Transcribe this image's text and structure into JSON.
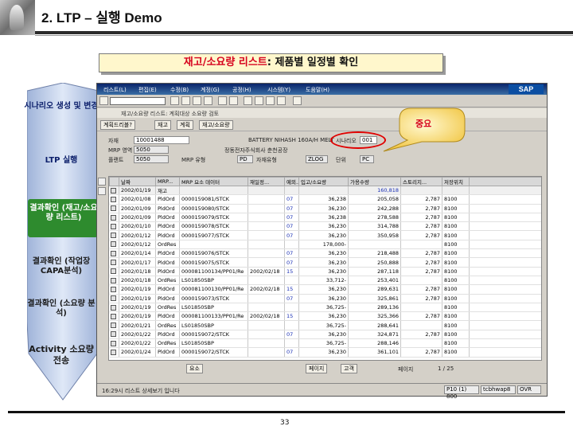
{
  "slide": {
    "title": "2. LTP – 실행 Demo",
    "subtitle_red": "재고/소요량 리스트",
    "subtitle_rest": ": 제품별 일정별 확인",
    "page_number": "33"
  },
  "process_steps": [
    {
      "label": "시나리오 생성 및 변경"
    },
    {
      "label": "LTP 실행"
    },
    {
      "label": "결과확인 (재고/소요량 리스트)"
    },
    {
      "label": "결과확인 (작업장 CAPA분석)"
    },
    {
      "label": "결과확인 (소요량 분석)"
    },
    {
      "label": "Activity 소요량 전송"
    }
  ],
  "callout": {
    "text": "중요"
  },
  "sap": {
    "menu": [
      "리스트(L)",
      "편집(E)",
      "수정(B)",
      "계정(G)",
      "공정(H)",
      "시스템(Y)",
      "도움말(H)"
    ],
    "title": "재고/소요량 리스트: 계획대상 소요량 검토",
    "app_toolbar": [
      "계획드리블?",
      "재고",
      "계획",
      "재고/소요량"
    ],
    "header": {
      "material_label": "자재",
      "material_value": "10001488",
      "material_desc": "BATTERY NIHASH 160A/H MELT",
      "mrp_area_label": "MRP 영역",
      "mrp_area_value": "5050",
      "mrp_area_desc": "정동전자주식회사 춘천공장",
      "plant_label": "플랜트",
      "plant_value": "5050",
      "mrp_type_label": "MRP 유형",
      "mrp_type_value": "PD",
      "material_type_label": "자재유형",
      "material_type_value": "ZLOG",
      "unit_label": "단위",
      "unit_value": "PC",
      "scenario_label": "시나리오",
      "scenario_value": "001"
    },
    "columns": [
      "날짜",
      "MRP...",
      "MRP 요소 데이터",
      "재일정...",
      "예외...",
      "입고/소요량",
      "가용수량",
      "스토리지...",
      "저장위치"
    ],
    "rows": [
      {
        "date": "2002/01/19",
        "mrp": "재고",
        "data": "",
        "resched": "",
        "exc": "",
        "qty": "",
        "avail": "160,818",
        "stor": "",
        "loc": ""
      },
      {
        "date": "2002/01/08",
        "mrp": "PldOrd",
        "data": "0000159081/STCK",
        "resched": "",
        "exc": "07",
        "qty": "36,238",
        "avail": "205,058",
        "stor": "2,787",
        "loc": "8100"
      },
      {
        "date": "2002/01/09",
        "mrp": "PldOrd",
        "data": "0000159080/STCK",
        "resched": "",
        "exc": "07",
        "qty": "36,230",
        "avail": "242,288",
        "stor": "2,787",
        "loc": "8100"
      },
      {
        "date": "2002/01/09",
        "mrp": "PldOrd",
        "data": "0000159079/STCK",
        "resched": "",
        "exc": "07",
        "qty": "36,238",
        "avail": "278,588",
        "stor": "2,787",
        "loc": "8100"
      },
      {
        "date": "2002/01/10",
        "mrp": "PldOrd",
        "data": "0000159078/STCK",
        "resched": "",
        "exc": "07",
        "qty": "36,230",
        "avail": "314,788",
        "stor": "2,787",
        "loc": "8100"
      },
      {
        "date": "2002/01/12",
        "mrp": "PldOrd",
        "data": "0000159077/STCK",
        "resched": "",
        "exc": "07",
        "qty": "36,230",
        "avail": "350,958",
        "stor": "2,787",
        "loc": "8100"
      },
      {
        "date": "2002/01/12",
        "mrp": "OrdRes",
        "data": "",
        "resched": "",
        "exc": "",
        "qty": "178,000-",
        "avail": "",
        "stor": "",
        "loc": "8100"
      },
      {
        "date": "2002/01/14",
        "mrp": "PldOrd",
        "data": "0000159076/STCK",
        "resched": "",
        "exc": "07",
        "qty": "36,230",
        "avail": "218,488",
        "stor": "2,787",
        "loc": "8100"
      },
      {
        "date": "2002/01/17",
        "mrp": "PldOrd",
        "data": "0000159075/STCK",
        "resched": "",
        "exc": "07",
        "qty": "36,230",
        "avail": "250,888",
        "stor": "2,787",
        "loc": "8100"
      },
      {
        "date": "2002/01/18",
        "mrp": "PldOrd",
        "data": "000081100134/PP01/Re",
        "resched": "2002/02/18",
        "exc": "15",
        "qty": "36,230",
        "avail": "287,118",
        "stor": "2,787",
        "loc": "8100"
      },
      {
        "date": "2002/01/18",
        "mrp": "OrdRes",
        "data": "LS01850SBP",
        "resched": "",
        "exc": "",
        "qty": "33,712-",
        "avail": "253,401",
        "stor": "",
        "loc": "8100"
      },
      {
        "date": "2002/01/19",
        "mrp": "PldOrd",
        "data": "000081100130/PP01/Re",
        "resched": "2002/02/18",
        "exc": "15",
        "qty": "36,230",
        "avail": "289,631",
        "stor": "2,787",
        "loc": "8100"
      },
      {
        "date": "2002/01/19",
        "mrp": "PldOrd",
        "data": "0000159073/STCK",
        "resched": "",
        "exc": "07",
        "qty": "36,230",
        "avail": "325,861",
        "stor": "2,787",
        "loc": "8100"
      },
      {
        "date": "2002/01/19",
        "mrp": "OrdRes",
        "data": "LS01850SBP",
        "resched": "",
        "exc": "",
        "qty": "36,725-",
        "avail": "289,136",
        "stor": "",
        "loc": "8100"
      },
      {
        "date": "2002/01/19",
        "mrp": "PldOrd",
        "data": "000081100133/PP01/Re",
        "resched": "2002/02/18",
        "exc": "15",
        "qty": "36,230",
        "avail": "325,366",
        "stor": "2,787",
        "loc": "8100"
      },
      {
        "date": "2002/01/21",
        "mrp": "OrdRes",
        "data": "LS01850SBP",
        "resched": "",
        "exc": "",
        "qty": "36,725-",
        "avail": "288,641",
        "stor": "",
        "loc": "8100"
      },
      {
        "date": "2002/01/22",
        "mrp": "PldOrd",
        "data": "0000159072/STCK",
        "resched": "",
        "exc": "07",
        "qty": "36,230",
        "avail": "324,871",
        "stor": "2,787",
        "loc": "8100"
      },
      {
        "date": "2002/01/22",
        "mrp": "OrdRes",
        "data": "LS01850SBP",
        "resched": "",
        "exc": "",
        "qty": "36,725-",
        "avail": "288,146",
        "stor": "",
        "loc": "8100"
      },
      {
        "date": "2002/01/24",
        "mrp": "PldOrd",
        "data": "0000159072/STCK",
        "resched": "",
        "exc": "07",
        "qty": "36,230",
        "avail": "361,101",
        "stor": "2,787",
        "loc": "8100"
      }
    ],
    "footer": {
      "btn1": "요소",
      "btn2": "페이지",
      "btn3": "고객",
      "page_label": "페이지",
      "page_value": "1 / 25"
    },
    "status": {
      "message": "16:29시 리스트 상세보기 입니다",
      "field1": "P10 (1) 800",
      "field2": "tcbhwap8",
      "field3": "OVR"
    }
  }
}
